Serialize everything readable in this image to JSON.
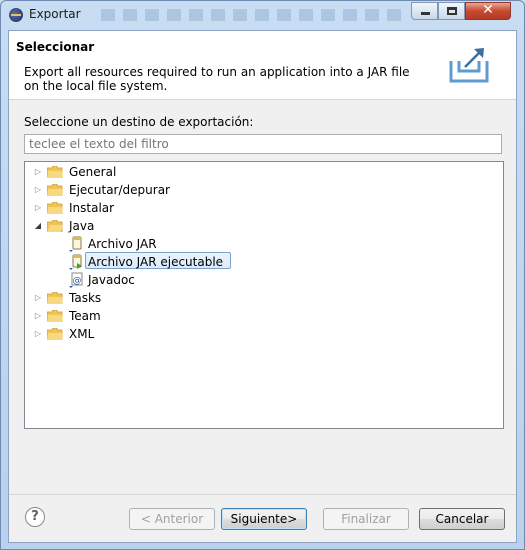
{
  "window": {
    "title": "Exportar"
  },
  "banner": {
    "title": "Seleccionar",
    "description": "Export all resources required to run an application into a JAR file on the local file system.",
    "icon": "export-box-icon"
  },
  "filter": {
    "label": "Seleccione un destino de exportación:",
    "placeholder": "teclee el texto del filtro"
  },
  "tree": {
    "items": [
      {
        "label": "General",
        "type": "folder",
        "expanded": false
      },
      {
        "label": "Ejecutar/depurar",
        "type": "folder",
        "expanded": false
      },
      {
        "label": "Instalar",
        "type": "folder",
        "expanded": false
      },
      {
        "label": "Java",
        "type": "folder",
        "expanded": true,
        "children": [
          {
            "label": "Archivo JAR",
            "icon": "jar-file-icon"
          },
          {
            "label": "Archivo JAR ejecutable",
            "icon": "runnable-jar-icon",
            "selected": true
          },
          {
            "label": "Javadoc",
            "icon": "javadoc-icon"
          }
        ]
      },
      {
        "label": "Tasks",
        "type": "folder",
        "expanded": false
      },
      {
        "label": "Team",
        "type": "folder",
        "expanded": false
      },
      {
        "label": "XML",
        "type": "folder",
        "expanded": false
      }
    ]
  },
  "buttons": {
    "back": "< Anterior",
    "next": "Siguiente>",
    "finish": "Finalizar",
    "cancel": "Cancelar"
  }
}
